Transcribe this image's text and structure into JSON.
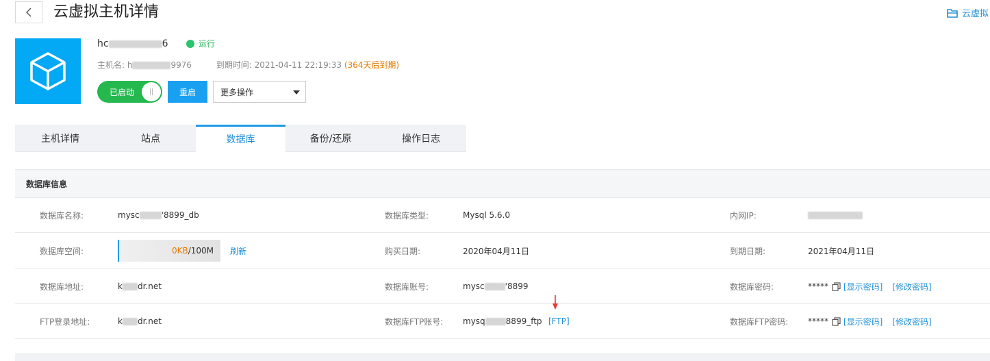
{
  "header": {
    "title": "云虚拟主机详情",
    "top_right_link": "云虚拟"
  },
  "host": {
    "name_prefix": "hc",
    "name_suffix": "6",
    "status": "运行",
    "hostname_label": "主机名:",
    "hostname_prefix": "h",
    "hostname_suffix": "9976",
    "expire_label": "到期时间:",
    "expire_time": "2021-04-11 22:19:33",
    "expire_note": "(364天后到期)",
    "toggle_label": "已启动",
    "restart_label": "重启",
    "more_ops_label": "更多操作"
  },
  "tabs": [
    {
      "label": "主机详情",
      "active": false
    },
    {
      "label": "站点",
      "active": false
    },
    {
      "label": "数据库",
      "active": true
    },
    {
      "label": "备份/还原",
      "active": false
    },
    {
      "label": "操作日志",
      "active": false
    }
  ],
  "db": {
    "section_title": "数据库信息",
    "name_label": "数据库名称:",
    "name_prefix": "mysc",
    "name_suffix": "'8899_db",
    "type_label": "数据库类型:",
    "type_value": "Mysql 5.6.0",
    "ip_label": "内网IP:",
    "space_label": "数据库空间:",
    "space_used": "0KB",
    "space_total": "/100M",
    "refresh_label": "刷新",
    "buy_label": "购买日期:",
    "buy_value": "2020年04月11日",
    "expire_label": "到期日期:",
    "expire_value": "2021年04月11日",
    "addr_label": "数据库地址:",
    "addr_prefix": "k",
    "addr_suffix": "dr.net",
    "account_label": "数据库账号:",
    "account_prefix": "mysc",
    "account_suffix": "'8899",
    "password_label": "数据库密码:",
    "password_mask": "*****",
    "show_password": "[显示密码]",
    "change_password": "[修改密码]",
    "ftp_addr_label": "FTP登录地址:",
    "ftp_addr_prefix": "k",
    "ftp_addr_suffix": "dr.net",
    "ftp_account_label": "数据库FTP账号:",
    "ftp_account_prefix": "mysq",
    "ftp_account_suffix": "8899_ftp",
    "ftp_link": "[FTP]",
    "ftp_password_label": "数据库FTP密码:",
    "ftp_password_mask": "*****",
    "ftp_show_password": "[显示密码]",
    "ftp_change_password": "[修改密码]"
  },
  "colors": {
    "accent": "#1e90d8",
    "running": "#2bc36b",
    "warning": "#e57a00",
    "host_icon_bg": "#03a9f4"
  }
}
